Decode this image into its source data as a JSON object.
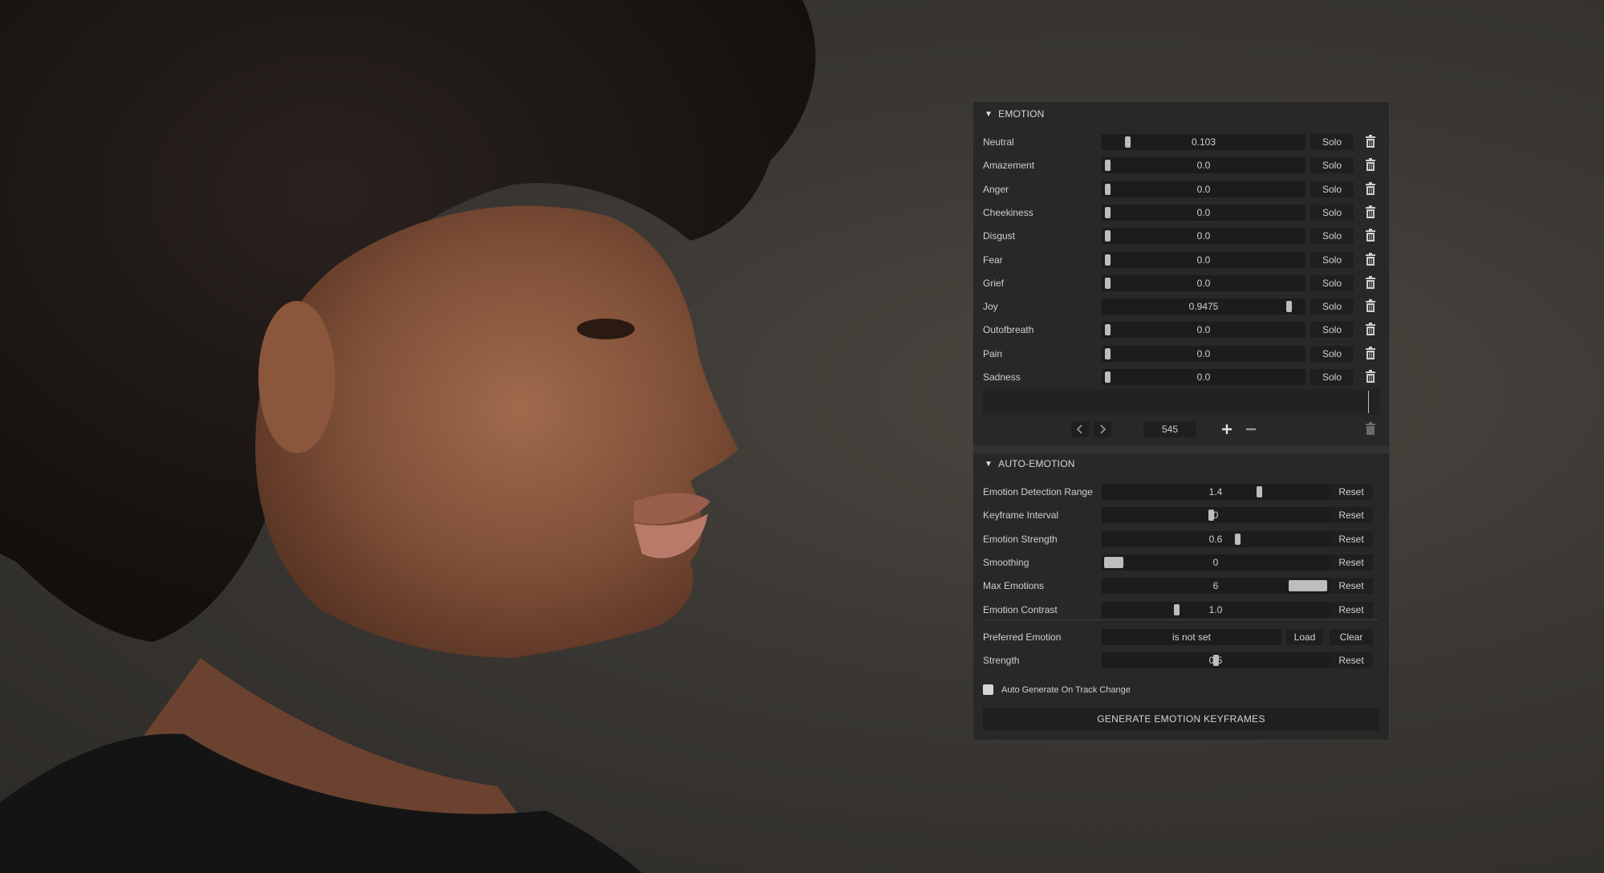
{
  "emotion_section": {
    "title": "EMOTION",
    "solo_label": "Solo",
    "rows": [
      {
        "label": "Neutral",
        "value": "0.103",
        "level": 0.103
      },
      {
        "label": "Amazement",
        "value": "0.0",
        "level": 0.0
      },
      {
        "label": "Anger",
        "value": "0.0",
        "level": 0.0
      },
      {
        "label": "Cheekiness",
        "value": "0.0",
        "level": 0.0
      },
      {
        "label": "Disgust",
        "value": "0.0",
        "level": 0.0
      },
      {
        "label": "Fear",
        "value": "0.0",
        "level": 0.0
      },
      {
        "label": "Grief",
        "value": "0.0",
        "level": 0.0
      },
      {
        "label": "Joy",
        "value": "0.9475",
        "level": 0.9475
      },
      {
        "label": "Outofbreath",
        "value": "0.0",
        "level": 0.0
      },
      {
        "label": "Pain",
        "value": "0.0",
        "level": 0.0
      },
      {
        "label": "Sadness",
        "value": "0.0",
        "level": 0.0
      }
    ],
    "frame_value": "545"
  },
  "auto_emotion_section": {
    "title": "AUTO-EMOTION",
    "reset_label": "Reset",
    "rows": [
      {
        "label": "Emotion Detection Range",
        "value": "1.4",
        "level": 0.7,
        "knob": "thin"
      },
      {
        "label": "Keyframe Interval",
        "value": "0",
        "level": 0.48,
        "knob": "thin"
      },
      {
        "label": "Emotion Strength",
        "value": "0.6",
        "level": 0.6,
        "knob": "thin"
      },
      {
        "label": "Smoothing",
        "value": "0",
        "level": 0.0,
        "knob": "wide"
      },
      {
        "label": "Max Emotions",
        "value": "6",
        "level": 1.0,
        "knob": "xwide"
      },
      {
        "label": "Emotion Contrast",
        "value": "1.0",
        "level": 0.32,
        "knob": "thin"
      }
    ],
    "preferred_emotion": {
      "label": "Preferred Emotion",
      "value": "is not set",
      "load_label": "Load",
      "clear_label": "Clear"
    },
    "strength": {
      "label": "Strength",
      "value": "0.5",
      "level": 0.5
    },
    "auto_generate_label": "Auto Generate On Track Change",
    "generate_button_label": "GENERATE EMOTION KEYFRAMES"
  },
  "icons": [
    "chevron-left-icon",
    "chevron-right-icon",
    "plus-icon",
    "minus-icon",
    "trash-icon",
    "collapse-triangle-icon"
  ],
  "colors": {
    "panel_bg": "#282828",
    "field_bg": "#1c1c1c",
    "knob": "#bdbdbd",
    "text": "#cfcfcf"
  }
}
